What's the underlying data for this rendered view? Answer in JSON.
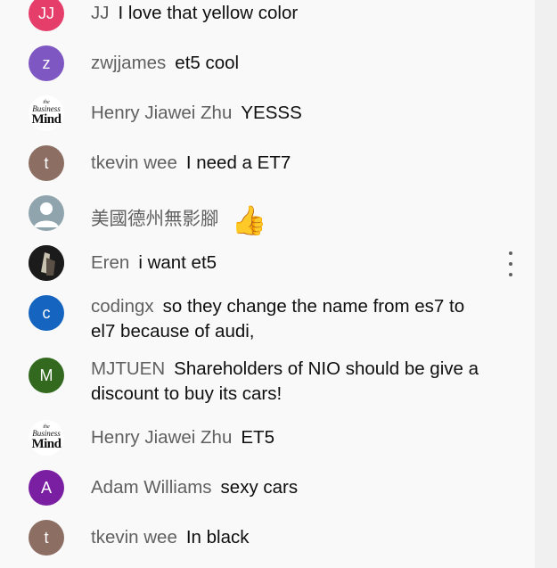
{
  "comments": [
    {
      "initials": "JJ",
      "color": "#e53e6b",
      "author": "JJ",
      "message": "I love that yellow color"
    },
    {
      "initials": "z",
      "color": "#7e57c2",
      "author": "zwjjames",
      "message": "et5 cool"
    },
    {
      "logo": [
        "the",
        "Business",
        "Mind"
      ],
      "author": "Henry Jiawei Zhu",
      "message": "YESSS"
    },
    {
      "initials": "t",
      "color": "#8d6e63",
      "author": "tkevin wee",
      "message": "I need a ET7"
    },
    {
      "author": "美國德州無影腳",
      "message": "",
      "emoji": "👍",
      "avatar": "person-icon",
      "color": "#90a4ae"
    },
    {
      "author": "Eren",
      "message": "i want et5",
      "avatar": "photo"
    },
    {
      "initials": "c",
      "color": "#1565c0",
      "author": "codingx",
      "message": "so they change the name from es7 to el7 because of audi,"
    },
    {
      "initials": "M",
      "color": "#33691e",
      "author": "MJTUEN",
      "message": "Shareholders of NIO should be give a discount to buy its cars!"
    },
    {
      "logo": [
        "the",
        "Business",
        "Mind"
      ],
      "author": "Henry Jiawei Zhu",
      "message": "ET5"
    },
    {
      "initials": "A",
      "color": "#7b1fa2",
      "author": "Adam Williams",
      "message": "sexy cars"
    },
    {
      "initials": "t",
      "color": "#8d6e63",
      "author": "tkevin wee",
      "message": "In black"
    }
  ]
}
